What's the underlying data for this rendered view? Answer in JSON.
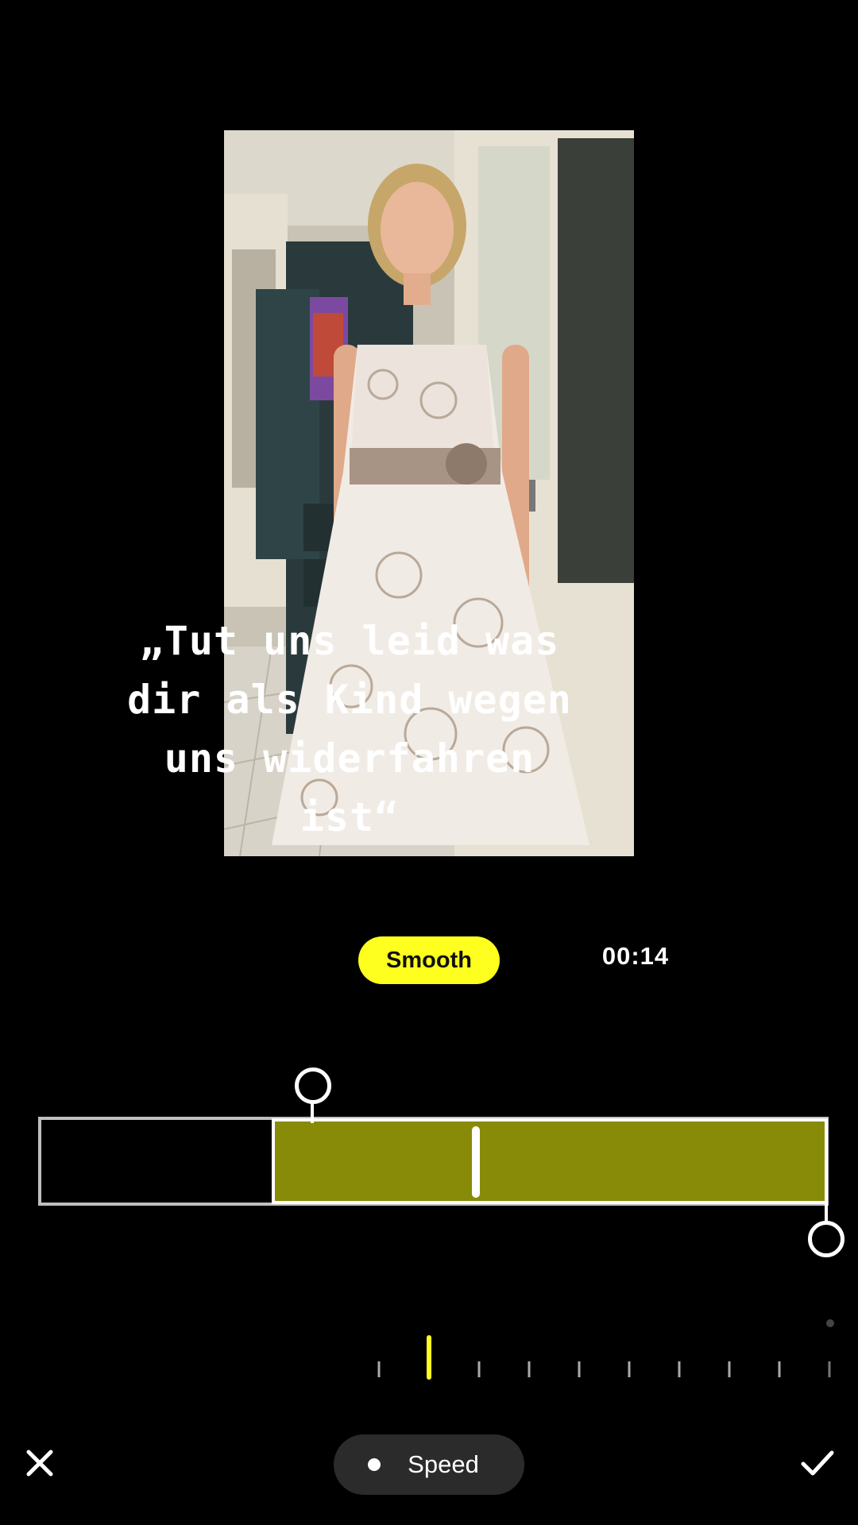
{
  "preview": {
    "caption": "„Tut uns leid was\ndir als Kind wegen\nuns widerfahren\nist“"
  },
  "controls": {
    "mode_label": "Smooth",
    "timecode": "00:14"
  },
  "trim": {
    "start_fraction": 0.35,
    "end_fraction": 1.0,
    "playhead_fraction": 0.56
  },
  "bottom_bar": {
    "close_icon": "close-icon",
    "confirm_icon": "checkmark-icon",
    "tool_label": "Speed"
  },
  "colors": {
    "accent": "#ffff1f",
    "selection": "#888b07"
  }
}
